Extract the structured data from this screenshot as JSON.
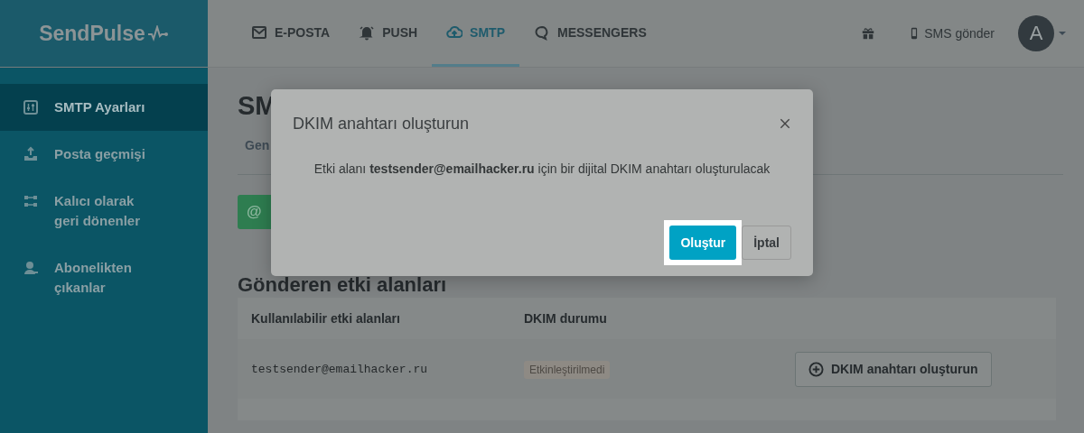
{
  "logo": {
    "text": "SendPulse"
  },
  "nav": [
    {
      "label": "E-POSTA",
      "selected": false
    },
    {
      "label": "PUSH",
      "selected": false
    },
    {
      "label": "SMTP",
      "selected": true
    },
    {
      "label": "MESSENGERS",
      "selected": false
    }
  ],
  "header_actions": {
    "sms": "SMS gönder",
    "avatar": "A"
  },
  "sidebar": {
    "items": [
      {
        "label": "SMTP Ayarları",
        "selected": true
      },
      {
        "label": "Posta geçmişi",
        "selected": false
      },
      {
        "label": "Kalıcı olarak geri dönenler",
        "selected": false
      },
      {
        "label": "Abonelikten çıkanlar",
        "selected": false
      }
    ]
  },
  "page": {
    "title": "SM",
    "tabs": [
      {
        "label": "Gen"
      }
    ],
    "add_button": "@",
    "section_title": "Gönderen etki alanları",
    "table": {
      "columns": [
        "Kullanılabilir etki alanları",
        "DKIM durumu"
      ],
      "rows": [
        {
          "domain": "testsender@emailhacker.ru",
          "status": "Etkinleştirilmedi",
          "action": "DKIM anahtarı oluşturun"
        }
      ]
    }
  },
  "dialog": {
    "title": "DKIM anahtarı oluşturun",
    "message": "Etki alanı **testsender@emailhacker.ru** için bir dijital DKIM anahtarı oluşturulacak",
    "buttons": [
      {
        "label": "Oluştur",
        "kind": "primary",
        "highlighted": true
      },
      {
        "label": "İptal",
        "kind": "secondary",
        "highlighted": false
      }
    ]
  }
}
